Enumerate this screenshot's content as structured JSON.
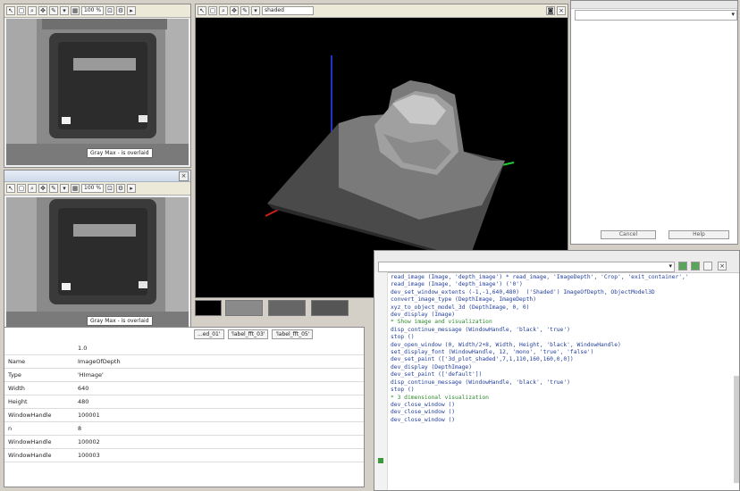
{
  "graphics_top": {
    "zoom": "100 %",
    "caption": "Gray  Max  -  is overlaid"
  },
  "graphics_bottom": {
    "title": "",
    "zoom": "100 %",
    "caption": "Gray  Max  -  is overlaid"
  },
  "viewer3d": {
    "mode_select": "shaded"
  },
  "variable_view": {
    "tabs": [
      "...ed_01'",
      "'label_fft_03'",
      "'label_fft_05'"
    ],
    "rows": [
      {
        "name": "",
        "value": "1.0"
      },
      {
        "name": "Name",
        "value": "ImageOfDepth"
      },
      {
        "name": "Type",
        "value": "'HImage'"
      },
      {
        "name": "Width",
        "value": "640"
      },
      {
        "name": "Height",
        "value": "480"
      },
      {
        "name": "WindowHandle",
        "value": "100001"
      },
      {
        "name": "n",
        "value": "8"
      },
      {
        "name": "WindowHandle",
        "value": "100002"
      },
      {
        "name": "WindowHandle",
        "value": "100003"
      }
    ]
  },
  "right_top": {
    "dropdown": "",
    "buttons": [
      "Cancel",
      "Help"
    ]
  },
  "program": {
    "procedure_select": "",
    "lines": [
      {
        "text": "read_image (Image, 'depth_image') * read_image, 'ImageDepth', 'Crop', 'exit_container','",
        "comment": false
      },
      {
        "text": "read_image (Image, 'depth_image') ('0')",
        "comment": false
      },
      {
        "text": "dev_set_window_extents (-1,-1,640,480)  ('Shaded') ImageOfDepth, ObjectModel3D",
        "comment": false
      },
      {
        "text": "convert_image_type (DepthImage, ImageDepth)",
        "comment": false
      },
      {
        "text": "xyz_to_object_model_3d (DepthImage, 0, 0)",
        "comment": false
      },
      {
        "text": "dev_display (Image)",
        "comment": false
      },
      {
        "text": "* Show image and visualization",
        "comment": true
      },
      {
        "text": "disp_continue_message (WindowHandle, 'black', 'true')",
        "comment": false
      },
      {
        "text": "stop ()",
        "comment": false
      },
      {
        "text": "dev_open_window (0, Width/2+8, Width, Height, 'black', WindowHandle)",
        "comment": false
      },
      {
        "text": "set_display_font (WindowHandle, 12, 'mono', 'true', 'false')",
        "comment": false
      },
      {
        "text": "dev_set_paint (['3d_plot_shaded',7,1,110,160,160,0,0])",
        "comment": false
      },
      {
        "text": "dev_display (DepthImage)",
        "comment": false
      },
      {
        "text": "dev_set_paint (['default'])",
        "comment": false
      },
      {
        "text": "disp_continue_message (WindowHandle, 'black', 'true')",
        "comment": false
      },
      {
        "text": "stop ()",
        "comment": false
      },
      {
        "text": "* 3 dimensional visualization",
        "comment": true
      },
      {
        "text": "dev_close_window ()",
        "comment": false
      },
      {
        "text": "dev_close_window ()",
        "comment": false
      },
      {
        "text": "dev_close_window ()",
        "comment": false
      }
    ]
  }
}
